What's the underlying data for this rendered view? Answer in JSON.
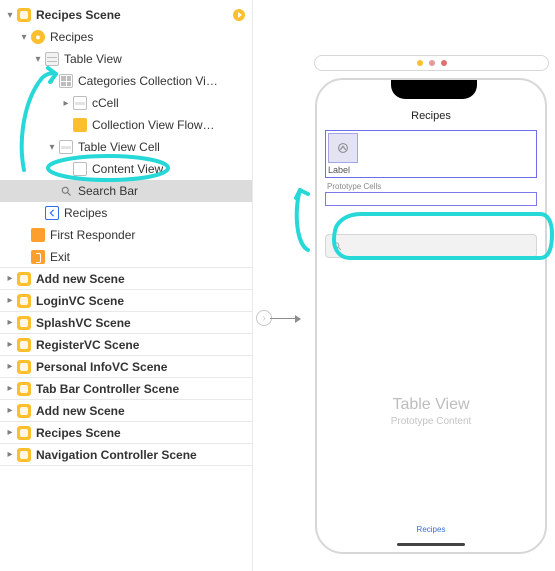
{
  "outline": {
    "header": "Recipes Scene",
    "items": [
      {
        "label": "Recipes"
      },
      {
        "label": "Table View"
      },
      {
        "label": "Categories Collection Vi…"
      },
      {
        "label": "cCell"
      },
      {
        "label": "Collection View Flow…"
      },
      {
        "label": "Table View Cell"
      },
      {
        "label": "Content View"
      },
      {
        "label": "Search Bar"
      },
      {
        "label": "Recipes"
      },
      {
        "label": "First Responder"
      },
      {
        "label": "Exit"
      }
    ],
    "scenes": [
      "Add new Scene",
      "LoginVC Scene",
      "SplashVC Scene",
      "RegisterVC Scene",
      "Personal InfoVC Scene",
      "Tab Bar Controller Scene",
      "Add new Scene",
      "Recipes Scene",
      "Navigation Controller Scene"
    ]
  },
  "preview": {
    "title": "Recipes",
    "cell_label": "Label",
    "proto_caption": "Prototype Cells",
    "tv_title": "Table View",
    "tv_sub": "Prototype Content",
    "bottom": "Recipes"
  }
}
